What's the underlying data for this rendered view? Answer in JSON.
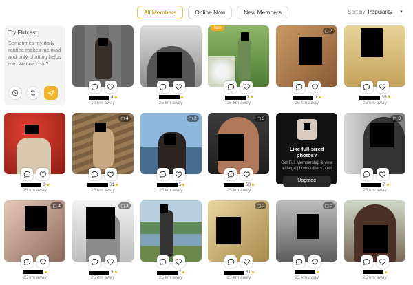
{
  "filters": {
    "tabs": [
      {
        "label": "All Members",
        "active": true
      },
      {
        "label": "Online Now",
        "active": false
      },
      {
        "label": "New Members",
        "active": false
      }
    ],
    "sort_label": "Sort by",
    "sort_value": "Popularity"
  },
  "flirtcast": {
    "title": "Try Flirtcast",
    "message": "Sometimes my daily routine makes me mad and only chatting helps me. Wanna chat?"
  },
  "upsell": {
    "title": "Like full-sized photos?",
    "body": "Get Full Membership & view all large photos others post!",
    "button": "Upgrade"
  },
  "members": [
    {
      "age": "4",
      "distance": "10 km away",
      "photos": "",
      "new": false
    },
    {
      "age": "",
      "distance": "25 km away",
      "photos": "",
      "new": false
    },
    {
      "age": "3",
      "distance": "25 km away",
      "photos": "",
      "new": true,
      "badge": "New"
    },
    {
      "age": "1",
      "distance": "25 km away",
      "photos": "3",
      "new": false
    },
    {
      "age": "35",
      "distance": "25 km away",
      "photos": "",
      "new": false
    },
    {
      "age": "3",
      "distance": "25 km away",
      "photos": "",
      "new": false
    },
    {
      "age": "31",
      "distance": "25 km away",
      "photos": "4",
      "new": false
    },
    {
      "age": "5",
      "distance": "25 km away",
      "photos": "2",
      "new": false
    },
    {
      "age": "50",
      "distance": "25 km away",
      "photos": "3",
      "new": false
    },
    {
      "age": "7",
      "distance": "25 km away",
      "photos": "3",
      "new": false
    },
    {
      "age": "",
      "distance": "25 km away",
      "photos": "4",
      "new": false
    },
    {
      "age": "3",
      "distance": "25 km away",
      "photos": "3",
      "new": false
    },
    {
      "age": "7",
      "distance": "25 km away",
      "photos": "",
      "new": false
    },
    {
      "age": "51",
      "distance": "25 km away",
      "photos": "2",
      "new": false
    },
    {
      "age": "",
      "distance": "25 km away",
      "photos": "2",
      "new": false
    },
    {
      "age": "",
      "distance": "25 km away",
      "photos": "",
      "new": false
    }
  ],
  "icons": {
    "chat": "chat-bubble-icon",
    "like": "heart-icon",
    "history": "clock-icon",
    "refresh": "refresh-icon",
    "send": "send-icon"
  },
  "colors": {
    "accent": "#f0b42a",
    "badge_new": "#f2a81d"
  }
}
